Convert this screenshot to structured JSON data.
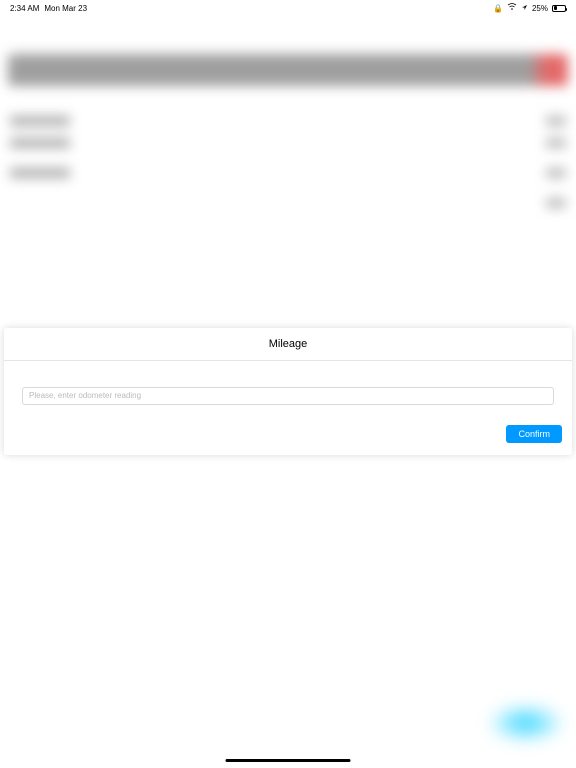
{
  "statusbar": {
    "time": "2:34 AM",
    "date": "Mon Mar 23",
    "battery_percent": "25%"
  },
  "modal": {
    "title": "Mileage",
    "input_placeholder": "Please, enter odometer reading",
    "confirm_label": "Confirm"
  }
}
